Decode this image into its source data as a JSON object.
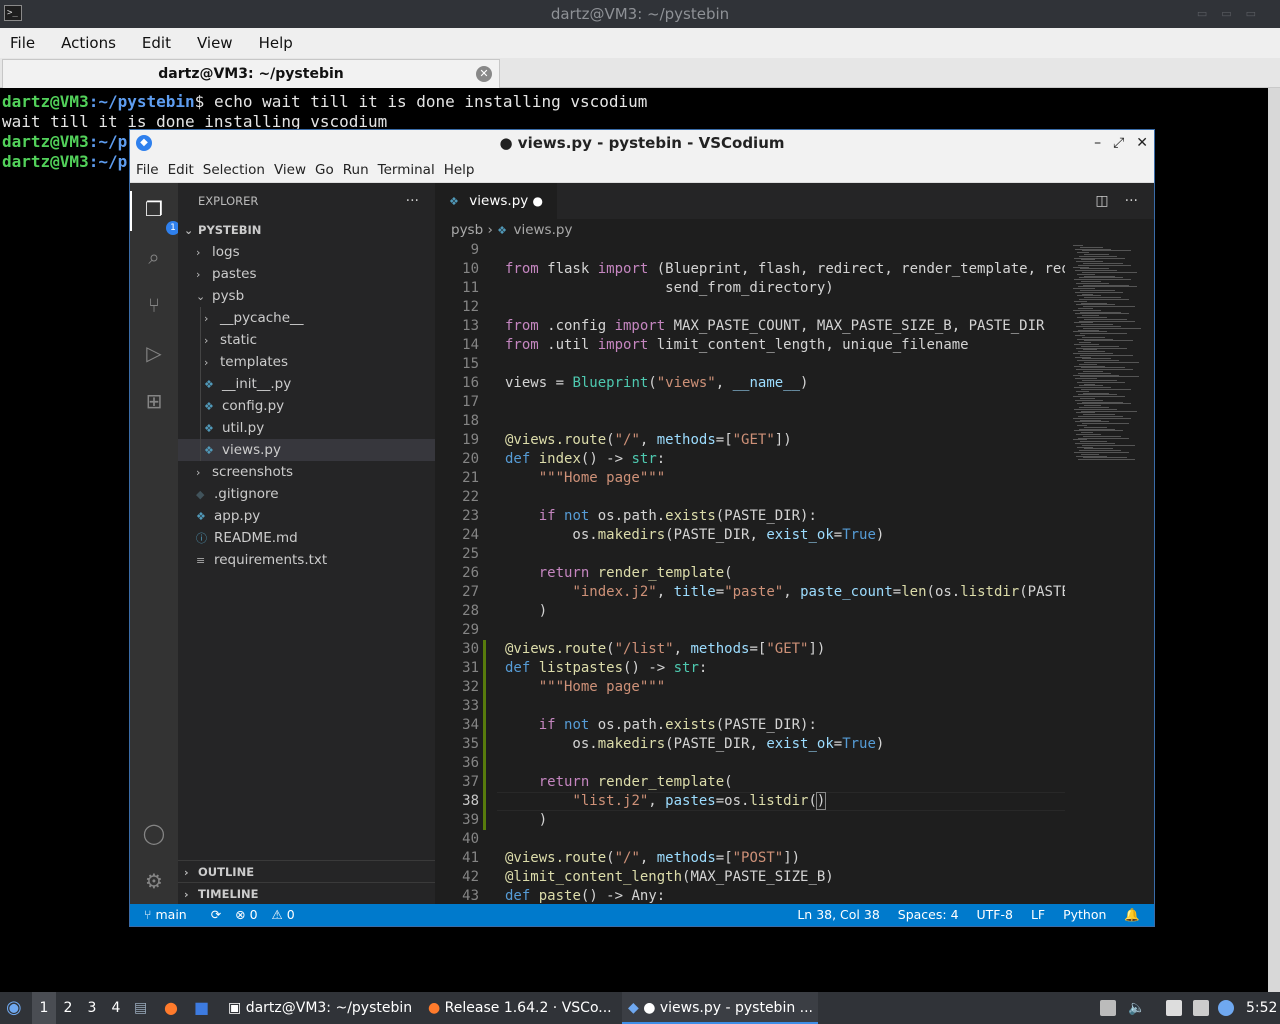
{
  "terminal": {
    "title": "dartz@VM3: ~/pystebin",
    "menu": [
      "File",
      "Actions",
      "Edit",
      "View",
      "Help"
    ],
    "tab_label": "dartz@VM3: ~/pystebin",
    "lines": [
      {
        "user": "dartz@VM3",
        "path": ":~/pystebin",
        "prompt": "$",
        "cmd": " echo wait till it is done installing vscodium"
      },
      {
        "output": "wait till it is done installing vscodium"
      },
      {
        "user": "dartz@VM3",
        "path": ":~/p",
        "prompt": "",
        "cmd": ""
      },
      {
        "user": "dartz@VM3",
        "path": ":~/p",
        "prompt": "",
        "cmd": ""
      }
    ]
  },
  "vscodium": {
    "title": "● views.py - pystebin - VSCodium",
    "menu": [
      "File",
      "Edit",
      "Selection",
      "View",
      "Go",
      "Run",
      "Terminal",
      "Help"
    ],
    "explorer_badge": "1",
    "sidebar": {
      "header": "EXPLORER",
      "root": "PYSTEBIN",
      "items": [
        {
          "label": "logs",
          "depth": 1,
          "kind": "folder"
        },
        {
          "label": "pastes",
          "depth": 1,
          "kind": "folder"
        },
        {
          "label": "pysb",
          "depth": 1,
          "kind": "folder-open"
        },
        {
          "label": "__pycache__",
          "depth": 2,
          "kind": "folder"
        },
        {
          "label": "static",
          "depth": 2,
          "kind": "folder"
        },
        {
          "label": "templates",
          "depth": 2,
          "kind": "folder"
        },
        {
          "label": "__init__.py",
          "depth": 2,
          "kind": "py"
        },
        {
          "label": "config.py",
          "depth": 2,
          "kind": "py"
        },
        {
          "label": "util.py",
          "depth": 2,
          "kind": "py"
        },
        {
          "label": "views.py",
          "depth": 2,
          "kind": "py",
          "selected": true
        },
        {
          "label": "screenshots",
          "depth": 1,
          "kind": "folder"
        },
        {
          "label": ".gitignore",
          "depth": 1,
          "kind": "git"
        },
        {
          "label": "app.py",
          "depth": 1,
          "kind": "py"
        },
        {
          "label": "README.md",
          "depth": 1,
          "kind": "info"
        },
        {
          "label": "requirements.txt",
          "depth": 1,
          "kind": "list"
        }
      ],
      "outline": "OUTLINE",
      "timeline": "TIMELINE"
    },
    "tab": {
      "label": "views.py",
      "dirty": "●"
    },
    "breadcrumb": [
      "pysb",
      "views.py"
    ],
    "code_lines": [
      {
        "n": "9",
        "html": ""
      },
      {
        "n": "10",
        "html": "<span class='k'>from</span> flask <span class='k'>import</span> (Blueprint, flash, redirect, render_template, request,"
      },
      {
        "n": "11",
        "html": "                   send_from_directory)"
      },
      {
        "n": "12",
        "html": ""
      },
      {
        "n": "13",
        "html": "<span class='k'>from</span> .config <span class='k'>import</span> MAX_PASTE_COUNT, MAX_PASTE_SIZE_B, PASTE_DIR"
      },
      {
        "n": "14",
        "html": "<span class='k'>from</span> .util <span class='k'>import</span> limit_content_length, unique_filename"
      },
      {
        "n": "15",
        "html": ""
      },
      {
        "n": "16",
        "html": "views = <span class='t'>Blueprint</span>(<span class='s'>\"views\"</span>, <span class='v'>__name__</span>)"
      },
      {
        "n": "17",
        "html": ""
      },
      {
        "n": "18",
        "html": ""
      },
      {
        "n": "19",
        "html": "<span class='f'>@views.route</span>(<span class='s'>\"/\"</span>, <span class='v'>methods</span>=[<span class='s'>\"GET\"</span>])"
      },
      {
        "n": "20",
        "html": "<span class='b'>def</span> <span class='f'>index</span>() -> <span class='t'>str</span>:"
      },
      {
        "n": "21",
        "html": "    <span class='s'>\"\"\"Home page\"\"\"</span>"
      },
      {
        "n": "22",
        "html": ""
      },
      {
        "n": "23",
        "html": "    <span class='k'>if</span> <span class='b'>not</span> os.path.<span class='f'>exists</span>(PASTE_DIR):"
      },
      {
        "n": "24",
        "html": "        os.<span class='f'>makedirs</span>(PASTE_DIR, <span class='v'>exist_ok</span>=<span class='b'>True</span>)"
      },
      {
        "n": "25",
        "html": ""
      },
      {
        "n": "26",
        "html": "    <span class='k'>return</span> <span class='f'>render_template</span>("
      },
      {
        "n": "27",
        "html": "        <span class='s'>\"index.j2\"</span>, <span class='v'>title</span>=<span class='s'>\"paste\"</span>, <span class='v'>paste_count</span>=<span class='f'>len</span>(os.<span class='f'>listdir</span>(PASTE_DIR))"
      },
      {
        "n": "28",
        "html": "    )"
      },
      {
        "n": "29",
        "html": ""
      },
      {
        "n": "30",
        "html": "<span class='f'>@views.route</span>(<span class='s'>\"/list\"</span>, <span class='v'>methods</span>=[<span class='s'>\"GET\"</span>])"
      },
      {
        "n": "31",
        "html": "<span class='b'>def</span> <span class='f'>listpastes</span>() -> <span class='t'>str</span>:"
      },
      {
        "n": "32",
        "html": "    <span class='s'>\"\"\"Home page\"\"\"</span>"
      },
      {
        "n": "33",
        "html": ""
      },
      {
        "n": "34",
        "html": "    <span class='k'>if</span> <span class='b'>not</span> os.path.<span class='f'>exists</span>(PASTE_DIR):"
      },
      {
        "n": "35",
        "html": "        os.<span class='f'>makedirs</span>(PASTE_DIR, <span class='v'>exist_ok</span>=<span class='b'>True</span>)"
      },
      {
        "n": "36",
        "html": ""
      },
      {
        "n": "37",
        "html": "    <span class='k'>return</span> <span class='f'>render_template</span>("
      },
      {
        "n": "38",
        "html": "        <span class='s'>\"list.j2\"</span>, <span class='v'>pastes</span>=os.<span class='f'>listdir</span>(<span style='outline:1px solid #888'>)</span>"
      },
      {
        "n": "39",
        "html": "    )"
      },
      {
        "n": "40",
        "html": ""
      },
      {
        "n": "41",
        "html": "<span class='f'>@views.route</span>(<span class='s'>\"/\"</span>, <span class='v'>methods</span>=[<span class='s'>\"POST\"</span>])"
      },
      {
        "n": "42",
        "html": "<span class='f'>@limit_content_length</span>(MAX_PASTE_SIZE_B)"
      },
      {
        "n": "43",
        "html": "<span class='b'>def</span> <span class='f'>paste</span>() -> Any:"
      }
    ],
    "status": {
      "branch": "main",
      "errors": "0",
      "warnings": "0",
      "position": "Ln 38, Col 38",
      "spaces": "Spaces: 4",
      "encoding": "UTF-8",
      "eol": "LF",
      "language": "Python"
    }
  },
  "taskbar": {
    "workspaces": [
      "1",
      "2",
      "3",
      "4"
    ],
    "windows": [
      {
        "label": "dartz@VM3: ~/pystebin"
      },
      {
        "label": "Release 1.64.2 · VSCo..."
      },
      {
        "label": "● views.py - pystebin ..."
      }
    ],
    "clock": "5:52"
  }
}
